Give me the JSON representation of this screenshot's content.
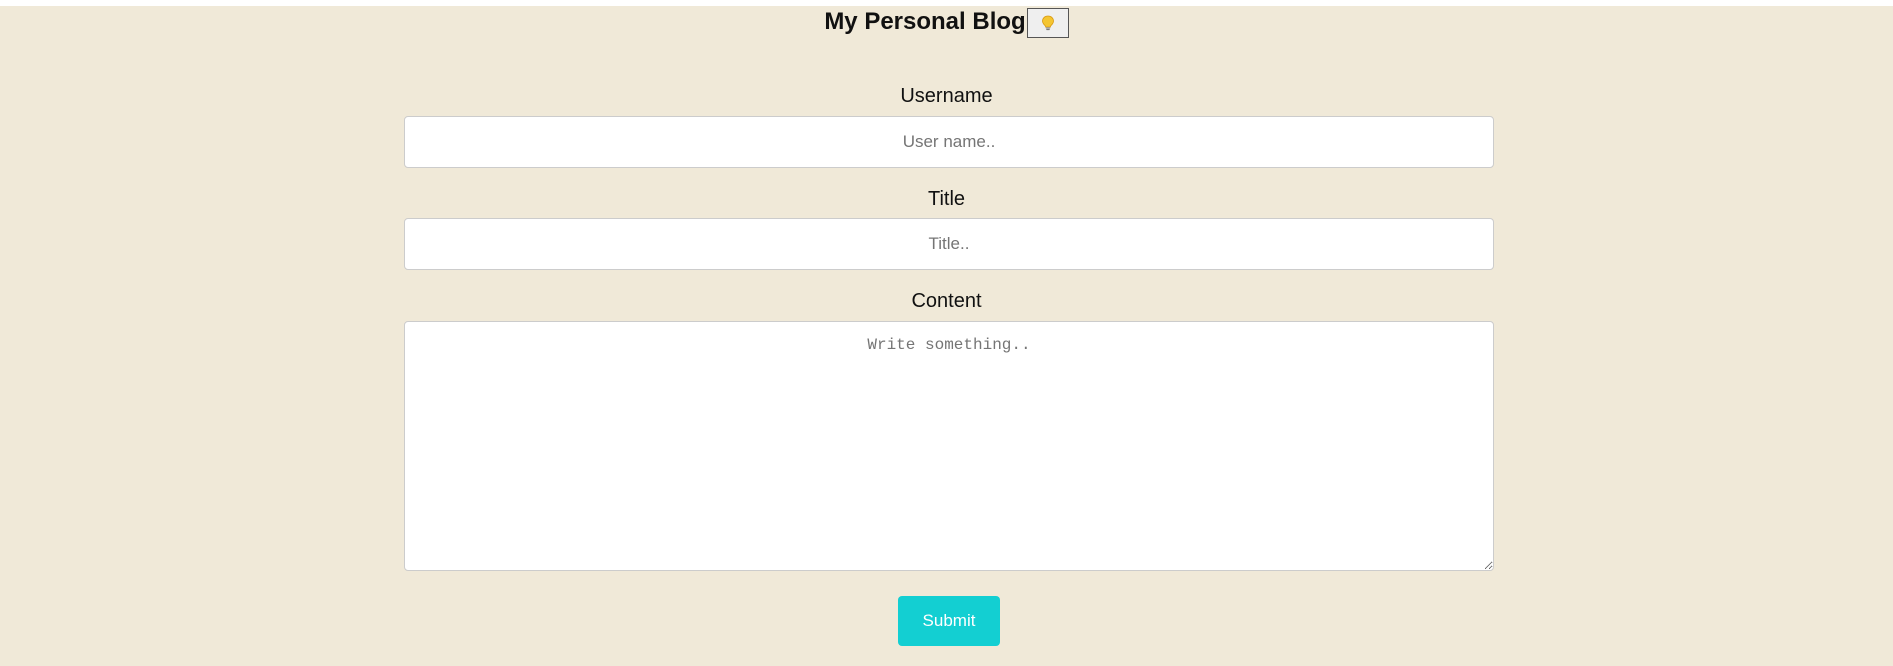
{
  "header": {
    "title": "My Personal Blog",
    "theme_toggle_icon": "lightbulb-icon"
  },
  "form": {
    "username": {
      "label": "Username",
      "placeholder": "User name.."
    },
    "title": {
      "label": "Title",
      "placeholder": "Title.."
    },
    "content": {
      "label": "Content",
      "placeholder": "Write something.."
    },
    "submit_label": "Submit"
  },
  "colors": {
    "page_background": "#f0e9d8",
    "submit_button": "#13cfd2",
    "bulb": "#f4c531"
  }
}
